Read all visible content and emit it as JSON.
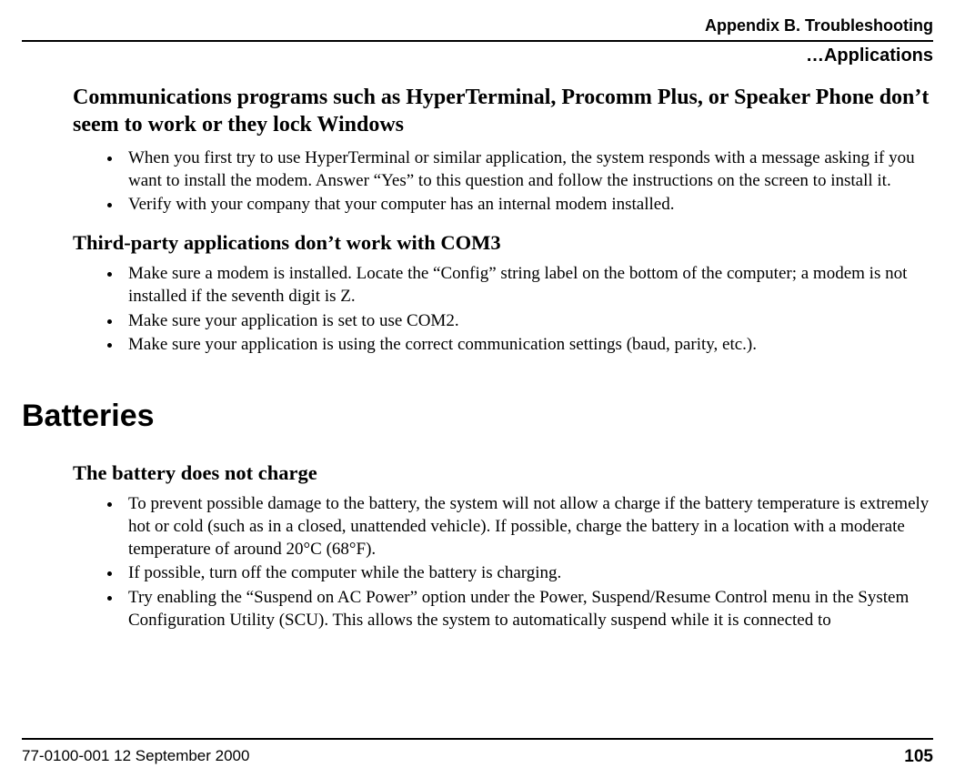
{
  "header": {
    "appendix": "Appendix B. Troubleshooting",
    "section_continued": "…Applications"
  },
  "body": {
    "h1": "Communications programs such as HyperTerminal, Procomm Plus, or Speaker Phone don’t seem to work or they lock Windows",
    "list1": [
      "When you first try to use HyperTerminal or similar application, the system responds with a message asking if you want to install the modem. Answer “Yes” to this question and follow the instructions on the screen to install it.",
      "Verify with your company that your computer has an internal modem installed."
    ],
    "h2": "Third-party applications don’t work with COM3",
    "list2": [
      "Make sure a modem is installed. Locate the “Config” string label on the bottom of the computer; a modem is not installed if the seventh digit is Z.",
      "Make sure your application is set to use COM2.",
      "Make sure your application is using the correct communication settings (baud, parity, etc.)."
    ],
    "section_title": "Batteries",
    "h3": "The battery does not charge",
    "list3": [
      "To prevent possible damage to the battery, the system will not allow a charge if the battery temperature is extremely hot or cold (such as in a closed, unattended vehicle). If possible, charge the battery in a location with a moderate temperature of around 20°C (68°F).",
      "If possible, turn off the computer while the battery is charging.",
      "Try enabling the “Suspend on AC Power” option under the Power, Suspend/Resume Control menu in the System Configuration Utility (SCU). This allows the system to automatically suspend while it is connected to"
    ]
  },
  "footer": {
    "doc_id": "77-0100-001   12 September 2000",
    "page_number": "105"
  }
}
